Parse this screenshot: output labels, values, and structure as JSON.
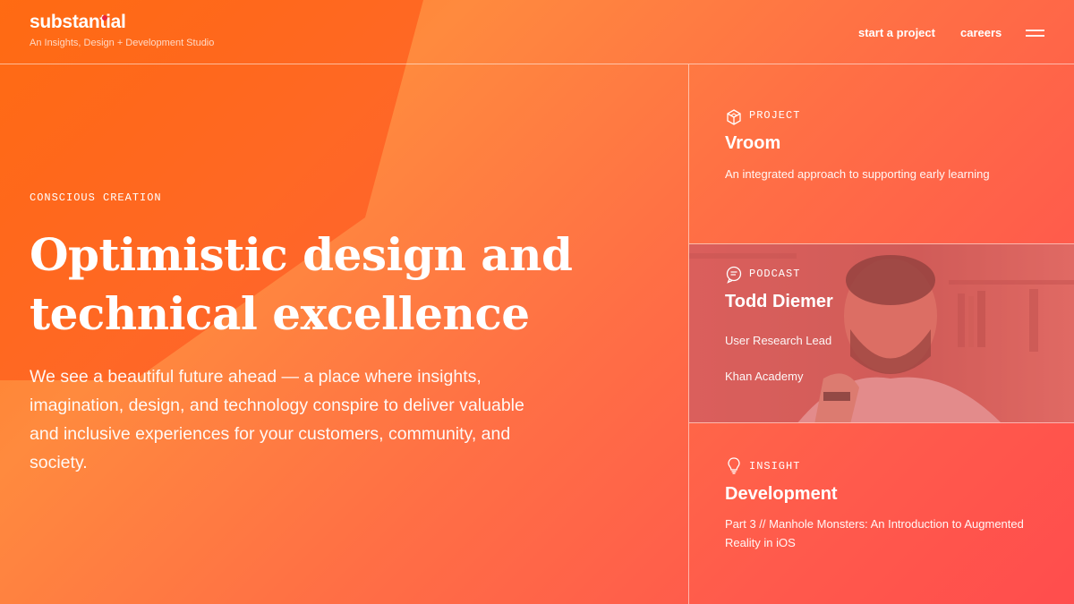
{
  "header": {
    "logo": "substantial",
    "tagline": "An Insights, Design + Development Studio",
    "nav": [
      "start a project",
      "careers"
    ],
    "menu_icon": "hamburger-menu-icon"
  },
  "hero": {
    "eyebrow": "CONSCIOUS CREATION",
    "headline": "Optimistic design and technical excellence",
    "intro": "We see a beautiful future ahead — a place where insights, imagination, design, and technology conspire to deliver valuable and inclusive experiences for your customers, community, and society."
  },
  "cards": [
    {
      "type": "PROJECT",
      "icon": "cube-icon",
      "title": "Vroom",
      "description": "An integrated approach to supporting early learning"
    },
    {
      "type": "PODCAST",
      "icon": "speech-bubble-icon",
      "title": "Todd Diemer",
      "role": "User Research Lead",
      "company": "Khan Academy"
    },
    {
      "type": "INSIGHT",
      "icon": "lightbulb-icon",
      "title": "Development",
      "description": "Part 3 // Manhole Monsters: An Introduction to Augmented Reality in iOS"
    }
  ],
  "colors": {
    "gradient_start": "#ff7a1c",
    "gradient_end": "#ff4d4d",
    "logo_dot": "#e8263e",
    "text": "#ffffff"
  }
}
